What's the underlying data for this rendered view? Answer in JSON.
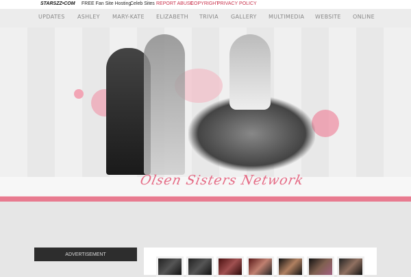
{
  "topbar": {
    "logo": "STARSZZ•COM",
    "links": [
      "FREE Fan Site Hosting",
      "Celeb Sites"
    ],
    "red_links": [
      "REPORT ABUSE",
      "COPYRIGHT",
      "PRIVACY POLICY"
    ]
  },
  "nav": [
    "UPDATES",
    "ASHLEY",
    "MARY-KATE",
    "ELIZABETH",
    "TRIVIA",
    "GALLERY",
    "MULTIMEDIA",
    "WEBSITE",
    "ONLINE"
  ],
  "header": {
    "title": "Olsen Sisters Network"
  },
  "sidebar": {
    "ad_label": "ADVERTISEMENT"
  },
  "colors": {
    "accent": "#e87a8f",
    "dark": "#2d2d2d"
  }
}
